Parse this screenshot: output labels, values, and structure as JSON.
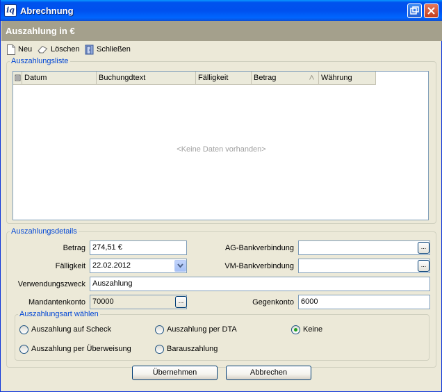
{
  "window": {
    "title": "Abrechnung",
    "app_icon": "iq"
  },
  "header": {
    "title": "Auszahlung in €"
  },
  "toolbar": {
    "new_label": "Neu",
    "delete_label": "Löschen",
    "close_label": "Schließen"
  },
  "list": {
    "legend": "Auszahlungsliste",
    "columns": [
      "Datum",
      "Buchungdtext",
      "Fälligkeit",
      "Betrag",
      "Währung"
    ],
    "empty_text": "<Keine Daten vorhanden>"
  },
  "details": {
    "legend": "Auszahlungsdetails",
    "betrag_label": "Betrag",
    "betrag_value": "274,51 €",
    "faelligkeit_label": "Fälligkeit",
    "faelligkeit_value": "22.02.2012",
    "verwendung_label": "Verwendungszweck",
    "verwendung_value": "Auszahlung",
    "mandant_label": "Mandantenkonto",
    "mandant_value": "70000",
    "ag_label": "AG-Bankverbindung",
    "ag_value": "",
    "vm_label": "VM-Bankverbindung",
    "vm_value": "",
    "gegenkonto_label": "Gegenkonto",
    "gegenkonto_value": "6000",
    "ellipsis": "..."
  },
  "payment_type": {
    "legend": "Auszahlungsart wählen",
    "options": [
      "Auszahlung auf Scheck",
      "Auszahlung per DTA",
      "Keine",
      "Auszahlung per Überweisung",
      "Barauszahlung"
    ],
    "selected": "Keine"
  },
  "buttons": {
    "apply": "Übernehmen",
    "cancel": "Abbrechen"
  },
  "colors": {
    "titlebar": "#0054E3",
    "header_band": "#A4A08C",
    "legend_text": "#0046D5",
    "radio_selected": "#21A121"
  }
}
